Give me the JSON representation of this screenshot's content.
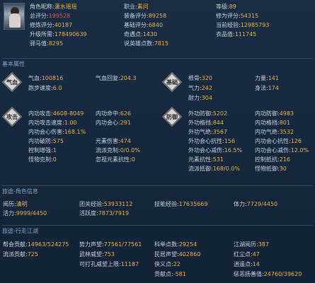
{
  "header": {
    "role_label": "角色昵称:",
    "role_value": "潇水瑶瑶",
    "job_label": "职业:",
    "job_value": "素问",
    "level_label": "等级:",
    "level_value": "89",
    "total_score_label": "总评分:",
    "total_score_value": "199528",
    "equip_score_label": "装备评分:",
    "equip_score_value": "89258",
    "cultivation_score_label": "修为评分:",
    "cultivation_score_value": "54315",
    "practice_score_label": "修炼评分:",
    "practice_score_value": "40187",
    "base_score_label": "基础评分:",
    "base_score_value": "6840",
    "current_exp_label": "当前经验:",
    "current_exp_value": "12985793",
    "upgrade_need_label": "升级所需:",
    "upgrade_need_value": "178490639",
    "qiyu_label": "奇遇点:",
    "qiyu_value": "1430",
    "wardrobe_label": "衣品值:",
    "wardrobe_value": "111745",
    "yiyue_label": "驿马值:",
    "yiyue_value": "8295",
    "talk_label": "说英雄点数:",
    "talk_value": "7815"
  },
  "basic": {
    "title": "基本属性",
    "qixue_badge": "气血",
    "jichu_badge": "基础",
    "gongji_badge": "攻击",
    "fangyu_badge": "防御",
    "hp_label": "气血:",
    "hp_value": "100816",
    "hp_regen_label": "气血回复:",
    "hp_regen_value": "204.3",
    "move_label": "跑步速度:",
    "move_value": "6.0",
    "genggu_label": "根骨:",
    "genggu_value": "320",
    "liliang_label": "力量:",
    "liliang_value": "141",
    "qili_label": "气力:",
    "qili_value": "242",
    "shenfa_label": "身法:",
    "shenfa_value": "174",
    "naili_label": "耐力:",
    "naili_value": "304",
    "atk": [
      {
        "label": "内功攻击:",
        "value": "4608-8049"
      },
      {
        "label": "内功命中:",
        "value": "626"
      },
      {
        "label": "内功攻击速度:",
        "value": "1.00"
      },
      {
        "label": "内功会心:",
        "value": "291"
      },
      {
        "label": "内功会心伤害:",
        "value": "168.1%"
      },
      {
        "label": "内功破防:",
        "value": "575"
      },
      {
        "label": "元素伤害:",
        "value": "474"
      },
      {
        "label": "控制增强:",
        "value": "1"
      },
      {
        "label": "流派克制:",
        "value": "0/0.0%"
      },
      {
        "label": "怪物克制:",
        "value": "0"
      },
      {
        "label": "忽视元素抗性:",
        "value": "0"
      }
    ],
    "def": [
      {
        "label": "外功防御:",
        "value": "5202"
      },
      {
        "label": "内功防御:",
        "value": "4983"
      },
      {
        "label": "外功格挡:",
        "value": "844"
      },
      {
        "label": "内功格挡:",
        "value": "801"
      },
      {
        "label": "外功气绝:",
        "value": "3567"
      },
      {
        "label": "内功气绝:",
        "value": "3532"
      },
      {
        "label": "外功会心抗性:",
        "value": "156"
      },
      {
        "label": "内功会心抗性:",
        "value": "126"
      },
      {
        "label": "外功会心减伤:",
        "value": "16.5%"
      },
      {
        "label": "内功会心减伤:",
        "value": "12.0%"
      },
      {
        "label": "元素抗性:",
        "value": "531"
      },
      {
        "label": "控制抵抗:",
        "value": "216"
      },
      {
        "label": "流派抵御:",
        "value": "168/0.0%"
      },
      {
        "label": "怪物抵御:",
        "value": "30"
      }
    ]
  },
  "role_info": {
    "title": "旅途-角色信息",
    "yueli_label": "阅历:",
    "yueli_value": "清明",
    "tuanguan_label": "团关经验:",
    "tuanguan_value": "53933112",
    "jineng_label": "技能经验:",
    "jineng_value": "17635669",
    "tili_label": "体力:",
    "tili_value": "7729/4450",
    "huoli_label": "活力:",
    "huoli_value": "9999/4450",
    "huoyue_label": "活跃度:",
    "huoyue_value": "7873/7919"
  },
  "jianghu": {
    "title": "旅途-行走江湖",
    "bhgx_label": "帮会贡献:",
    "bhgx_value": "14963/524275",
    "slsw_label": "势力声望:",
    "slsw_value": "77561/77561",
    "kjd_label": "科举点数:",
    "kjd_value": "29254",
    "jhjd_label": "江湖阅历:",
    "jhjd_value": "387",
    "lpgx_label": "流派贡献:",
    "lpgx_value": "725",
    "wlww_label": "武林威望:",
    "wlww_value": "753",
    "mjsw_label": "民居声望:",
    "mjsw_value": "402860",
    "hcd_label": "红尘点:",
    "hcd_value": "47",
    "kyys_label": "可打孔威望上限:",
    "kyys_value": "11187",
    "xyz_label": "侠义点:",
    "xyz_value": "22",
    "ytz_label": "逍遥点:",
    "ytz_value": "14",
    "gjz_label": "贡献点:",
    "gjz_value": "-581",
    "cepr_label": "惩恶扬善值:",
    "cepr_value": "24760/39620"
  }
}
